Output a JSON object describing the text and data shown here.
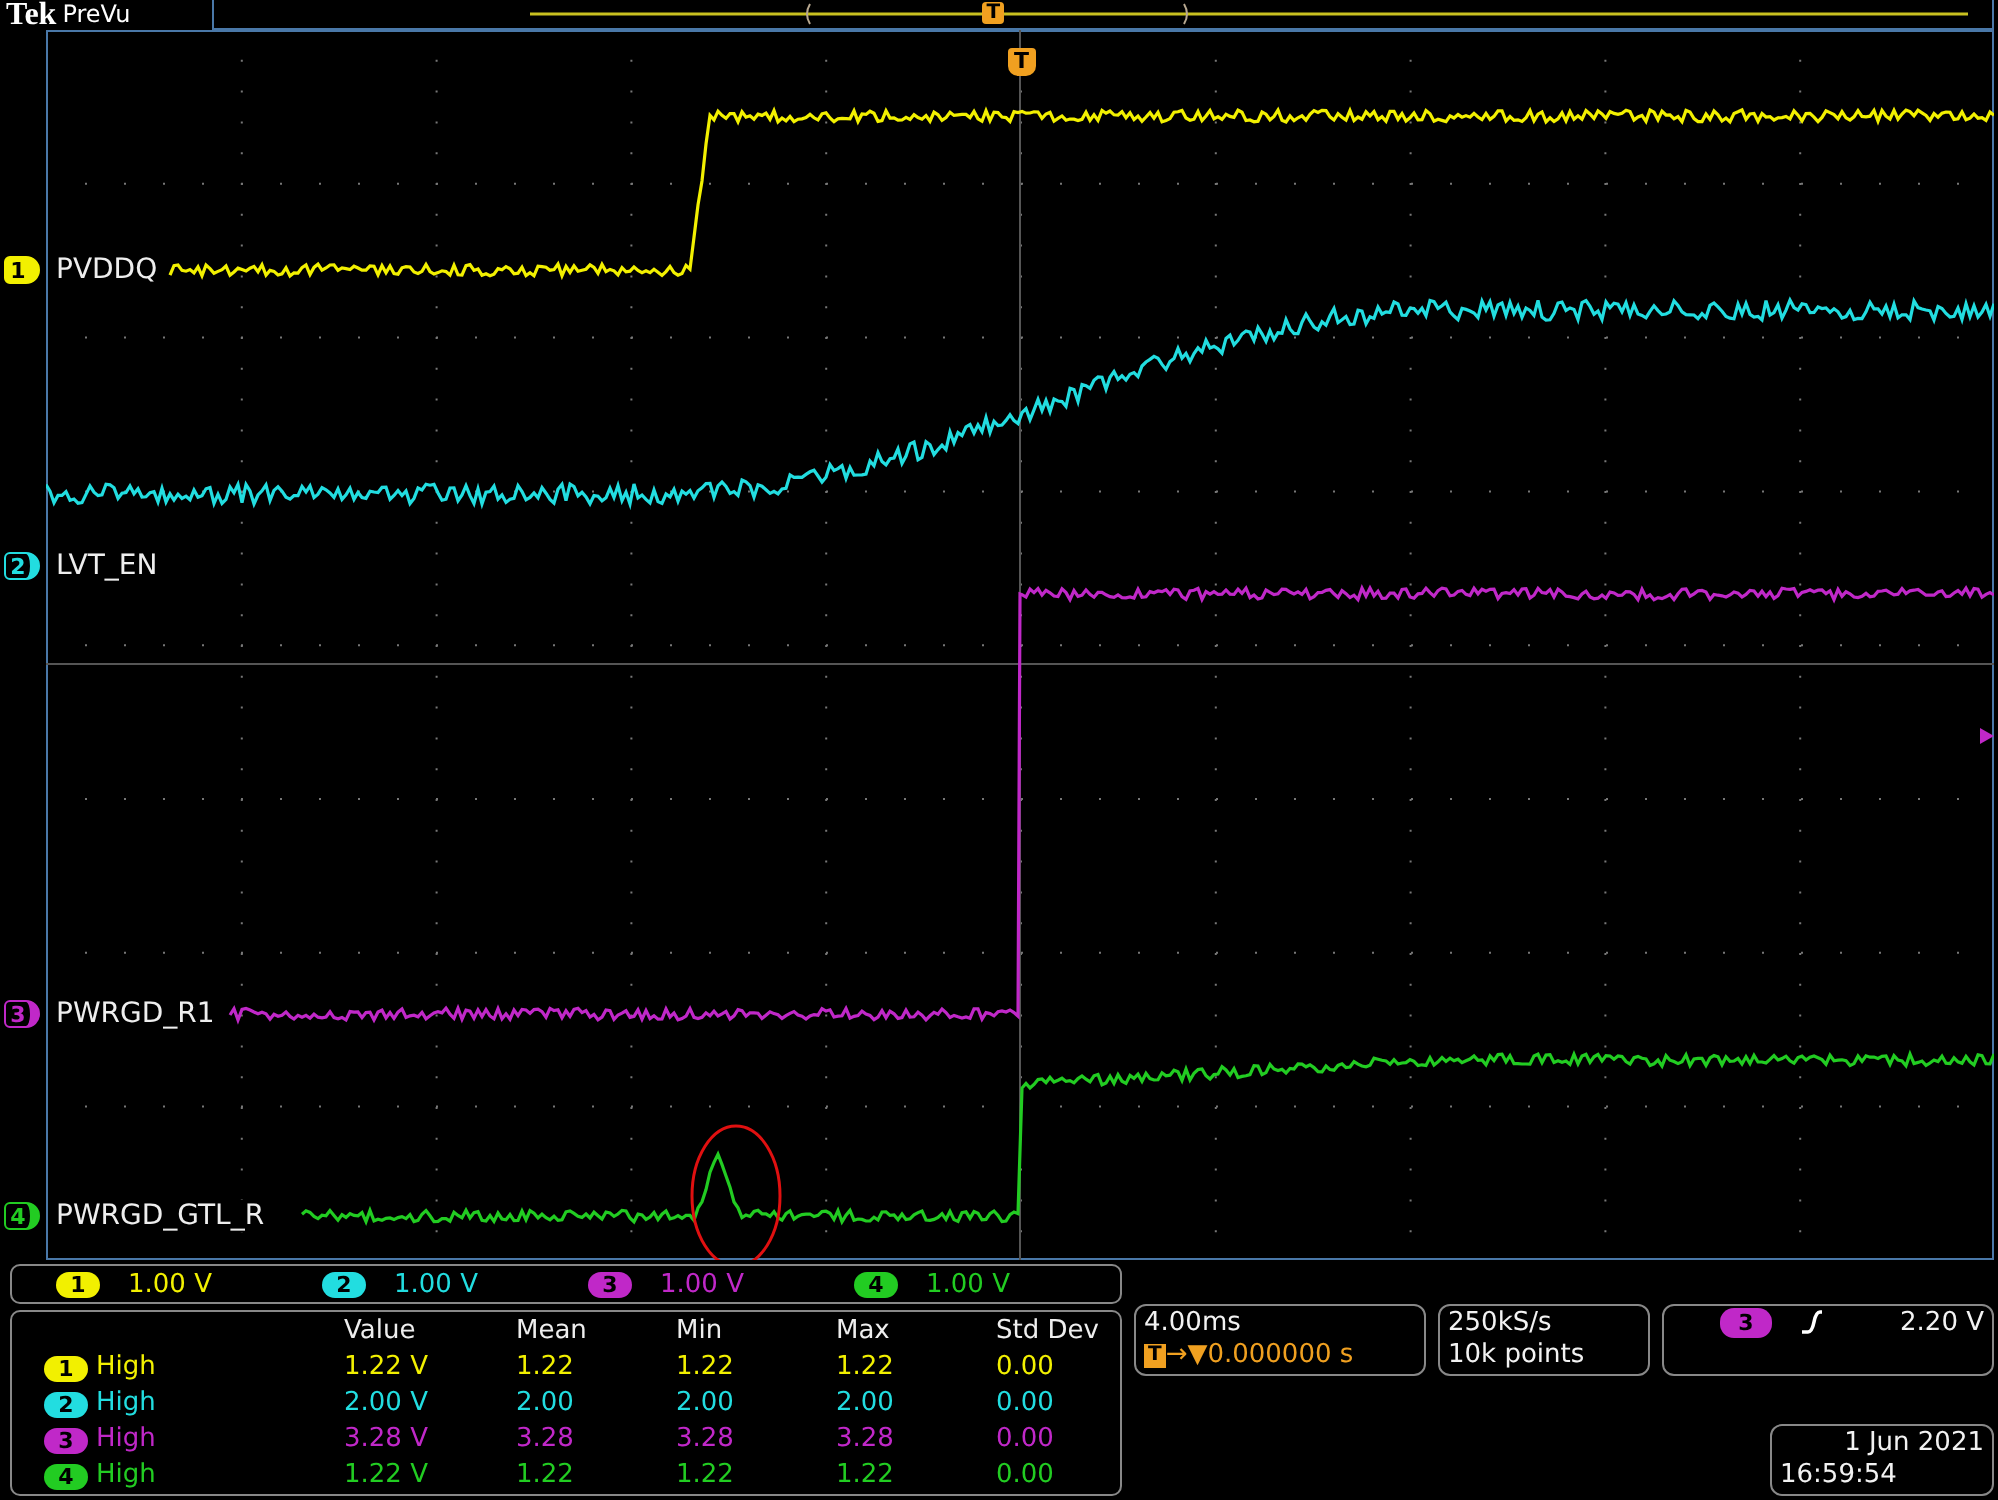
{
  "header": {
    "brand": "Tek",
    "mode": "PreVu",
    "trigger_label": "T"
  },
  "graticule": {
    "trigger_label": "T"
  },
  "channels": [
    {
      "number": "1",
      "label": "PVDDQ",
      "color": "#f2f000",
      "selected": true,
      "scale_badge": "1",
      "scale": "1.00 V"
    },
    {
      "number": "2",
      "label": "LVT_EN",
      "color": "#22dde0",
      "selected": false,
      "scale_badge": "2",
      "scale": "1.00 V"
    },
    {
      "number": "3",
      "label": "PWRGD_R1",
      "color": "#c028c8",
      "selected": false,
      "scale_badge": "3",
      "scale": "1.00 V"
    },
    {
      "number": "4",
      "label": "PWRGD_GTL_R",
      "color": "#22cc22",
      "selected": false,
      "scale_badge": "4",
      "scale": "1.00 V"
    }
  ],
  "measurements": {
    "columns": [
      "Value",
      "Mean",
      "Min",
      "Max",
      "Std Dev"
    ],
    "rows": [
      {
        "channel": "1",
        "color": "#f2f000",
        "name": "High",
        "cells": [
          "1.22 V",
          "1.22",
          "1.22",
          "1.22",
          "0.00"
        ]
      },
      {
        "channel": "2",
        "color": "#22dde0",
        "name": "High",
        "cells": [
          "2.00 V",
          "2.00",
          "2.00",
          "2.00",
          "0.00"
        ]
      },
      {
        "channel": "3",
        "color": "#c028c8",
        "name": "High",
        "cells": [
          "3.28 V",
          "3.28",
          "3.28",
          "3.28",
          "0.00"
        ]
      },
      {
        "channel": "4",
        "color": "#22cc22",
        "name": "High",
        "cells": [
          "1.22 V",
          "1.22",
          "1.22",
          "1.22",
          "0.00"
        ]
      }
    ]
  },
  "horizontal": {
    "scale": "4.00ms",
    "trigger_badge": "T",
    "position_arrows": "→▼",
    "position": "0.000000 s"
  },
  "acquisition": {
    "sample_rate": "250kS/s",
    "record_length": "10k points"
  },
  "trigger": {
    "source": "3",
    "color": "#c028c8",
    "level": "2.20 V"
  },
  "datetime": {
    "date": "1 Jun 2021",
    "time": "16:59:54"
  }
}
